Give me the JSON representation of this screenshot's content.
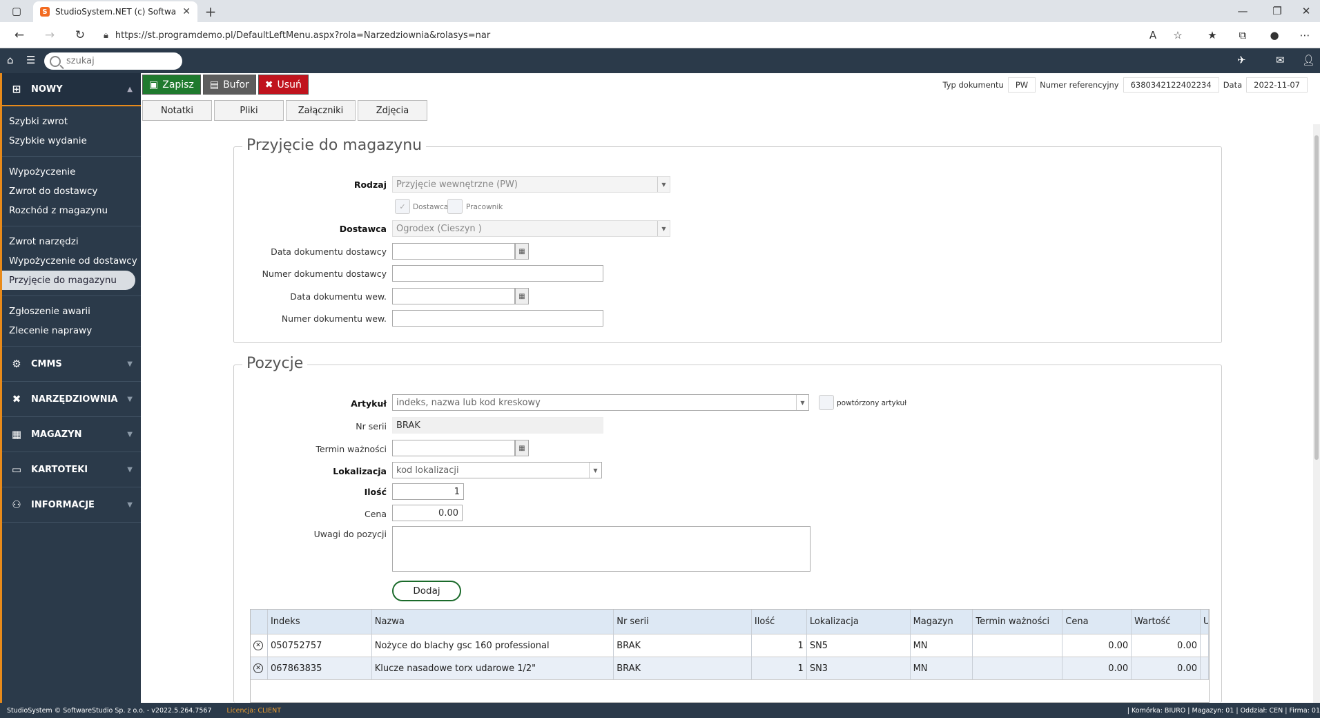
{
  "browser": {
    "tab_title": "StudioSystem.NET (c) SoftwareSt",
    "url": "https://st.programdemo.pl/DefaultLeftMenu.aspx?rola=Narzedziownia&rolasys=nar"
  },
  "header": {
    "search_placeholder": "szukaj"
  },
  "sidebar": {
    "new_label": "NOWY",
    "groups": [
      [
        "Szybki zwrot",
        "Szybkie wydanie"
      ],
      [
        "Wypożyczenie",
        "Zwrot do dostawcy",
        "Rozchód z magazynu"
      ],
      [
        "Zwrot narzędzi",
        "Wypożyczenie od dostawcy",
        "Przyjęcie do magazynu"
      ],
      [
        "Zgłoszenie awarii",
        "Zlecenie naprawy"
      ]
    ],
    "sections": [
      "CMMS",
      "NARZĘDZIOWNIA",
      "MAGAZYN",
      "KARTOTEKI",
      "INFORMACJE"
    ]
  },
  "toolbar": {
    "save": "Zapisz",
    "buffer": "Bufor",
    "delete": "Usuń"
  },
  "subtabs": [
    "Notatki",
    "Pliki",
    "Załączniki",
    "Zdjęcia"
  ],
  "docinfo": {
    "type_label": "Typ dokumentu",
    "type_value": "PW",
    "ref_label": "Numer referencyjny",
    "ref_value": "6380342122402234",
    "date_label": "Data",
    "date_value": "2022-11-07"
  },
  "receipt": {
    "legend": "Przyjęcie do magazynu",
    "kind_label": "Rodzaj",
    "kind_value": "Przyjęcie wewnętrzne (PW)",
    "chk_supplier": "Dostawca",
    "chk_employee": "Pracownik",
    "supplier_label": "Dostawca",
    "supplier_value": "Ogrodex (Cieszyn )",
    "supplier_doc_date": "Data dokumentu dostawcy",
    "supplier_doc_no": "Numer dokumentu dostawcy",
    "int_doc_date": "Data dokumentu wew.",
    "int_doc_no": "Numer dokumentu wew."
  },
  "positions": {
    "legend": "Pozycje",
    "article_label": "Artykuł",
    "article_placeholder": "indeks, nazwa lub kod kreskowy",
    "repeated_label": "powtórzony artykuł",
    "serial_label": "Nr serii",
    "serial_value": "BRAK",
    "expiry_label": "Termin ważności",
    "location_label": "Lokalizacja",
    "location_placeholder": "kod lokalizacji",
    "qty_label": "Ilość",
    "qty_value": "1",
    "price_label": "Cena",
    "price_value": "0.00",
    "notes_label": "Uwagi do pozycji",
    "add_button": "Dodaj"
  },
  "grid": {
    "headers": [
      "Indeks",
      "Nazwa",
      "Nr serii",
      "Ilość",
      "Lokalizacja",
      "Magazyn",
      "Termin ważności",
      "Cena",
      "Wartość",
      "U"
    ],
    "rows": [
      [
        "050752757",
        "Nożyce do blachy gsc 160 professional",
        "BRAK",
        "1",
        "SN5",
        "MN",
        "",
        "0.00",
        "0.00"
      ],
      [
        "067863835",
        "Klucze nasadowe torx udarowe 1/2\"",
        "BRAK",
        "1",
        "SN3",
        "MN",
        "",
        "0.00",
        "0.00"
      ]
    ]
  },
  "footer": {
    "left": "StudioSystem © SoftwareStudio Sp. z o.o. - v2022.5.264.7567",
    "license": "Licencja: CLIENT",
    "right": "| Komórka: BIURO | Magazyn: 01 | Oddział: CEN | Firma: 01"
  }
}
